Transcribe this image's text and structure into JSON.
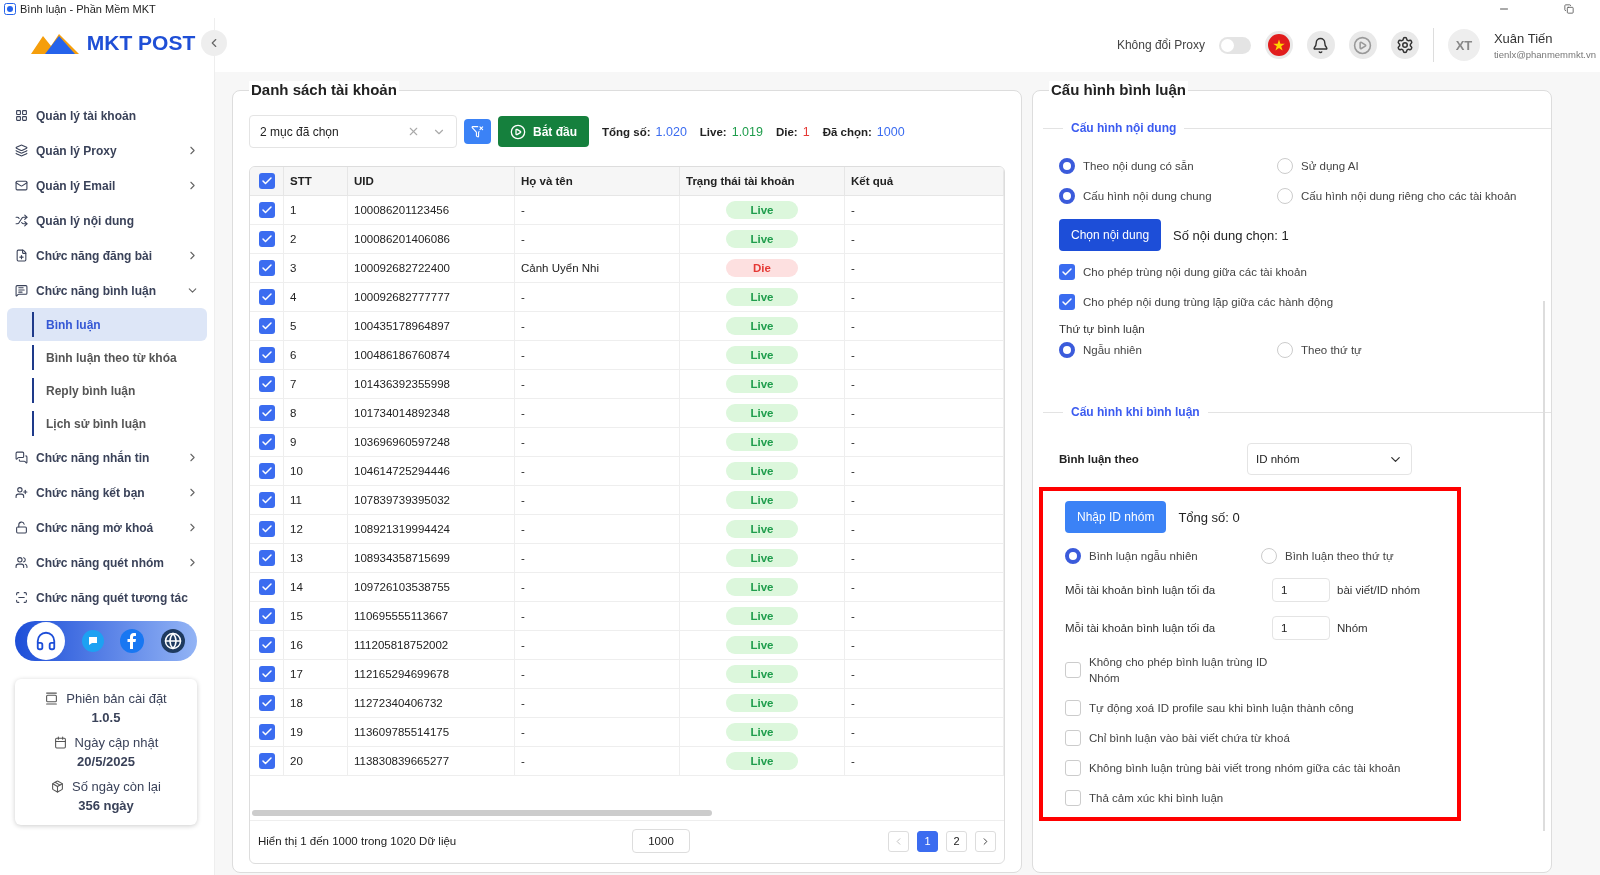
{
  "window": {
    "title": "Bình luận - Phần Mềm MKT"
  },
  "logo": {
    "text": "MKT POST"
  },
  "sidebar": {
    "items": [
      {
        "label": "Quản lý tài khoản",
        "has_arrow": false
      },
      {
        "label": "Quản lý Proxy",
        "has_arrow": true,
        "expanded": false
      },
      {
        "label": "Quản lý Email",
        "has_arrow": true,
        "expanded": false
      },
      {
        "label": "Quản lý nội dung",
        "has_arrow": false
      },
      {
        "label": "Chức năng đăng bài",
        "has_arrow": true,
        "expanded": false
      },
      {
        "label": "Chức năng bình luận",
        "has_arrow": true,
        "expanded": true,
        "children": [
          {
            "label": "Bình luận",
            "selected": true
          },
          {
            "label": "Bình luận theo từ khóa",
            "selected": false
          },
          {
            "label": "Reply bình luận",
            "selected": false
          },
          {
            "label": "Lịch sử bình luận",
            "selected": false
          }
        ]
      },
      {
        "label": "Chức năng nhắn tin",
        "has_arrow": true,
        "expanded": false
      },
      {
        "label": "Chức năng kết bạn",
        "has_arrow": true,
        "expanded": false
      },
      {
        "label": "Chức năng mở khoá",
        "has_arrow": true,
        "expanded": false
      },
      {
        "label": "Chức năng quét nhóm",
        "has_arrow": true,
        "expanded": false
      },
      {
        "label": "Chức năng quét tương tác",
        "has_arrow": false
      }
    ],
    "info": [
      {
        "label": "Phiên bản cài đặt",
        "value": "1.0.5"
      },
      {
        "label": "Ngày cập nhật",
        "value": "20/5/2025"
      },
      {
        "label": "Số ngày còn lại",
        "value": "356 ngày"
      }
    ]
  },
  "header": {
    "proxy_toggle": {
      "label": "Không đổi Proxy",
      "on": false
    },
    "user": {
      "initials": "XT",
      "name": "Xuân Tiến",
      "email": "tienlx@phanmemmkt.vn"
    }
  },
  "accounts": {
    "title": "Danh sách tài khoản",
    "select": {
      "value": "2 mục đã chọn"
    },
    "start_button": "Bắt đầu",
    "stats": [
      {
        "label": "Tổng số:",
        "value": "1.020",
        "color": "#3b6cf0"
      },
      {
        "label": "Live:",
        "value": "1.019",
        "color": "#1f9d4c"
      },
      {
        "label": "Die:",
        "value": "1",
        "color": "#e53935"
      },
      {
        "label": "Đã chọn:",
        "value": "1000",
        "color": "#3b6cf0"
      }
    ],
    "table": {
      "all_checked": true,
      "columns": [
        "STT",
        "UID",
        "Họ và tên",
        "Trạng thái tài khoản",
        "Kết quả"
      ],
      "rows": [
        {
          "stt": "1",
          "uid": "100086201123456",
          "name": "-",
          "status": "Live",
          "live": true,
          "result": "-",
          "checked": true
        },
        {
          "stt": "2",
          "uid": "100086201406086",
          "name": "-",
          "status": "Live",
          "live": true,
          "result": "-",
          "checked": true
        },
        {
          "stt": "3",
          "uid": "100092682722400",
          "name": "Cảnh Uyển Nhi",
          "status": "Die",
          "live": false,
          "result": "-",
          "checked": true
        },
        {
          "stt": "4",
          "uid": "100092682777777",
          "name": "-",
          "status": "Live",
          "live": true,
          "result": "-",
          "checked": true
        },
        {
          "stt": "5",
          "uid": "100435178964897",
          "name": "-",
          "status": "Live",
          "live": true,
          "result": "-",
          "checked": true
        },
        {
          "stt": "6",
          "uid": "100486186760874",
          "name": "-",
          "status": "Live",
          "live": true,
          "result": "-",
          "checked": true
        },
        {
          "stt": "7",
          "uid": "101436392355998",
          "name": "-",
          "status": "Live",
          "live": true,
          "result": "-",
          "checked": true
        },
        {
          "stt": "8",
          "uid": "101734014892348",
          "name": "-",
          "status": "Live",
          "live": true,
          "result": "-",
          "checked": true
        },
        {
          "stt": "9",
          "uid": "103696960597248",
          "name": "-",
          "status": "Live",
          "live": true,
          "result": "-",
          "checked": true
        },
        {
          "stt": "10",
          "uid": "104614725294446",
          "name": "-",
          "status": "Live",
          "live": true,
          "result": "-",
          "checked": true
        },
        {
          "stt": "11",
          "uid": "107839739395032",
          "name": "-",
          "status": "Live",
          "live": true,
          "result": "-",
          "checked": true
        },
        {
          "stt": "12",
          "uid": "108921319994424",
          "name": "-",
          "status": "Live",
          "live": true,
          "result": "-",
          "checked": true
        },
        {
          "stt": "13",
          "uid": "108934358715699",
          "name": "-",
          "status": "Live",
          "live": true,
          "result": "-",
          "checked": true
        },
        {
          "stt": "14",
          "uid": "109726103538755",
          "name": "-",
          "status": "Live",
          "live": true,
          "result": "-",
          "checked": true
        },
        {
          "stt": "15",
          "uid": "110695555113667",
          "name": "-",
          "status": "Live",
          "live": true,
          "result": "-",
          "checked": true
        },
        {
          "stt": "16",
          "uid": "111205818752002",
          "name": "-",
          "status": "Live",
          "live": true,
          "result": "-",
          "checked": true
        },
        {
          "stt": "17",
          "uid": "112165294699678",
          "name": "-",
          "status": "Live",
          "live": true,
          "result": "-",
          "checked": true
        },
        {
          "stt": "18",
          "uid": "11272340406732",
          "name": "-",
          "status": "Live",
          "live": true,
          "result": "-",
          "checked": true
        },
        {
          "stt": "19",
          "uid": "113609785514175",
          "name": "-",
          "status": "Live",
          "live": true,
          "result": "-",
          "checked": true
        },
        {
          "stt": "20",
          "uid": "113830839665277",
          "name": "-",
          "status": "Live",
          "live": true,
          "result": "-",
          "checked": true
        }
      ]
    },
    "footer": {
      "summary": "Hiển thị 1 đến 1000 trong 1020 Dữ liệu",
      "page_size": "1000",
      "pages": [
        {
          "label": "1",
          "selected": true
        },
        {
          "label": "2",
          "selected": false
        }
      ]
    }
  },
  "config": {
    "title": "Cấu hình bình luận",
    "content_section": {
      "title": "Cấu hình nội dung",
      "radio_rows": [
        [
          {
            "label": "Theo nội dung có sẵn",
            "selected": true
          },
          {
            "label": "Sử dụng AI",
            "selected": false
          }
        ],
        [
          {
            "label": "Cấu hình nội dung chung",
            "selected": true
          },
          {
            "label": "Cấu hình nội dung riêng cho các tài khoản",
            "selected": false
          }
        ]
      ],
      "choose_button": "Chọn nội dung",
      "count": "Số nội dung chọn: 1",
      "checks": [
        {
          "label": "Cho phép trùng nội dung giữa các tài khoản",
          "checked": true
        },
        {
          "label": "Cho phép nội dung trùng lặp giữa các hành động",
          "checked": true
        }
      ],
      "order_label": "Thứ tự bình luận",
      "order": [
        {
          "label": "Ngẫu nhiên",
          "selected": true
        },
        {
          "label": "Theo thứ tự",
          "selected": false
        }
      ]
    },
    "comment_section": {
      "title": "Cấu hình khi bình luận",
      "by_label": "Bình luận theo",
      "by_value": "ID nhóm",
      "import_button": "Nhập ID nhóm",
      "total": "Tổng số: 0",
      "mode": [
        {
          "label": "Bình luận ngẫu nhiên",
          "selected": true
        },
        {
          "label": "Bình luận theo thứ tự",
          "selected": false
        }
      ],
      "limits": [
        {
          "label": "Mỗi tài khoản bình luận tối đa",
          "value": "1",
          "unit": "bài viết/ID nhóm"
        },
        {
          "label": "Mỗi tài khoản bình luận tối đa",
          "value": "1",
          "unit": "Nhóm"
        }
      ],
      "checks": [
        {
          "label": "Không cho phép bình luận trùng ID Nhóm",
          "checked": false
        },
        {
          "label": "Tự động xoá ID profile sau khi bình luận thành công",
          "checked": false
        },
        {
          "label": "Chỉ bình luận vào bài viết chứa từ khoá",
          "checked": false
        },
        {
          "label": "Không bình luận trùng bài viết trong nhóm giữa các tài khoản",
          "checked": false
        },
        {
          "label": "Thả cảm xúc khi bình luận",
          "checked": false
        }
      ]
    }
  }
}
